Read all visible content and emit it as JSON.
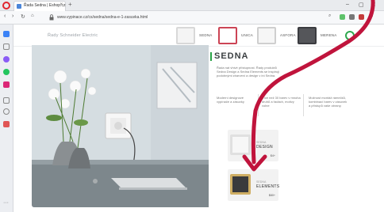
{
  "browser": {
    "tab_title": "Řada Sedna | Eshop.cz",
    "url": "www.vypinace.cz/cs/sedna/sedna-e-1-zasuvka.html",
    "window": {
      "minimize": "–",
      "maximize": "▢",
      "close": "✕"
    }
  },
  "site": {
    "brand": "Řady Schneider Electric",
    "series": [
      {
        "label": "SEDNA",
        "color": "#f4f4f4",
        "frame": "#d8d8d8"
      },
      {
        "label": "UNICA",
        "color": "#ffffff",
        "frame": "#cc4455"
      },
      {
        "label": "ASFORA",
        "color": "#f6f6f6",
        "frame": "#cfcfcf"
      },
      {
        "label": "MERENA",
        "color": "#55565a",
        "frame": "#3b3c40"
      }
    ]
  },
  "content": {
    "title": "SEDNA",
    "description": "Řada nat vhivé přístupnost. Řady produktů Sedna Design a Sedna Elements se inspirují podobnými zbarvení a design v ini Sedna.",
    "features": [
      "Moderní designové vypínače a zásuvky",
      "Více než 30 barev v mnoha druhů a řadách, motivy volne",
      "Možnost montáž rámečků, kombinací barev v zásuvek a přístupů vaše obrany."
    ]
  },
  "cards": [
    {
      "sub": "SEDNA",
      "name": "DESIGN",
      "price": "$4+",
      "thumb": "#f7f7f7",
      "frame": "#e0e0e0"
    },
    {
      "sub": "SEDNA",
      "name": "ELEMENTS",
      "price": "$80+",
      "thumb": "#3a3a3c",
      "frame": "#cfae63"
    }
  ],
  "colors": {
    "accent": "#29a346",
    "arrow": "#c0143c",
    "browser_logo": "#e0262e"
  },
  "icons": [
    "browser-logo-icon",
    "favicon-icon",
    "close-icon",
    "plus-icon",
    "back-icon",
    "forward-icon",
    "reload-icon",
    "home-icon",
    "lock-icon",
    "extension-icon",
    "bookmark-icon",
    "settings-icon"
  ]
}
